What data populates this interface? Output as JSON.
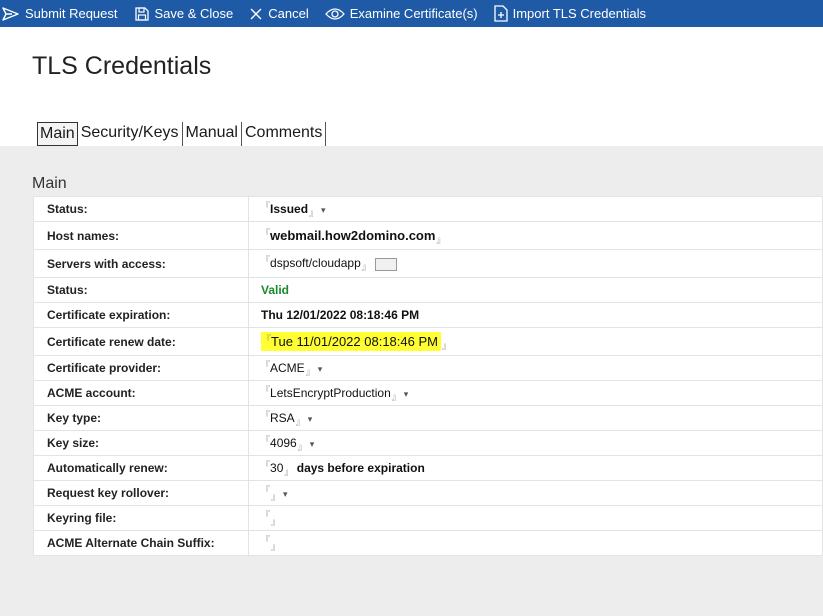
{
  "toolbar": {
    "submit": "Submit Request",
    "save_close": "Save & Close",
    "cancel": "Cancel",
    "examine": "Examine Certificate(s)",
    "import": "Import TLS Credentials"
  },
  "page": {
    "title": "TLS Credentials"
  },
  "tabs": [
    {
      "label": "Main",
      "active": true
    },
    {
      "label": "Security/Keys"
    },
    {
      "label": "Manual"
    },
    {
      "label": "Comments"
    }
  ],
  "section": {
    "title": "Main"
  },
  "fields": {
    "status": {
      "label": "Status:",
      "value": "Issued"
    },
    "host_names": {
      "label": "Host names:",
      "value": "webmail.how2domino.com"
    },
    "servers": {
      "label": "Servers with access:",
      "value": "dspsoft/cloudapp"
    },
    "status2": {
      "label": "Status:",
      "value": "Valid"
    },
    "expiration": {
      "label": "Certificate expiration:",
      "value": "Thu 12/01/2022 08:18:46 PM"
    },
    "renew_date": {
      "label": "Certificate renew date:",
      "value": "Tue 11/01/2022 08:18:46 PM"
    },
    "provider": {
      "label": "Certificate provider:",
      "value": "ACME"
    },
    "acme_account": {
      "label": "ACME account:",
      "value": "LetsEncryptProduction"
    },
    "key_type": {
      "label": "Key type:",
      "value": "RSA"
    },
    "key_size": {
      "label": "Key size:",
      "value": "4096"
    },
    "auto_renew": {
      "label": "Automatically renew:",
      "value": "30",
      "suffix": "days before expiration"
    },
    "key_rollover": {
      "label": "Request key rollover:",
      "value": ""
    },
    "keyring": {
      "label": "Keyring file:",
      "value": ""
    },
    "chain_suffix": {
      "label": "ACME Alternate Chain Suffix:",
      "value": ""
    }
  },
  "markers": {
    "open": "『",
    "close": "』",
    "caret": "▾"
  },
  "icons": {
    "submit": "send-icon",
    "save": "save-icon",
    "cancel": "close-icon",
    "examine": "eye-icon",
    "import": "import-file-icon"
  },
  "colors": {
    "toolbar": "#1e5aa6",
    "valid": "#1c8a2a",
    "highlight": "#ffff33"
  }
}
